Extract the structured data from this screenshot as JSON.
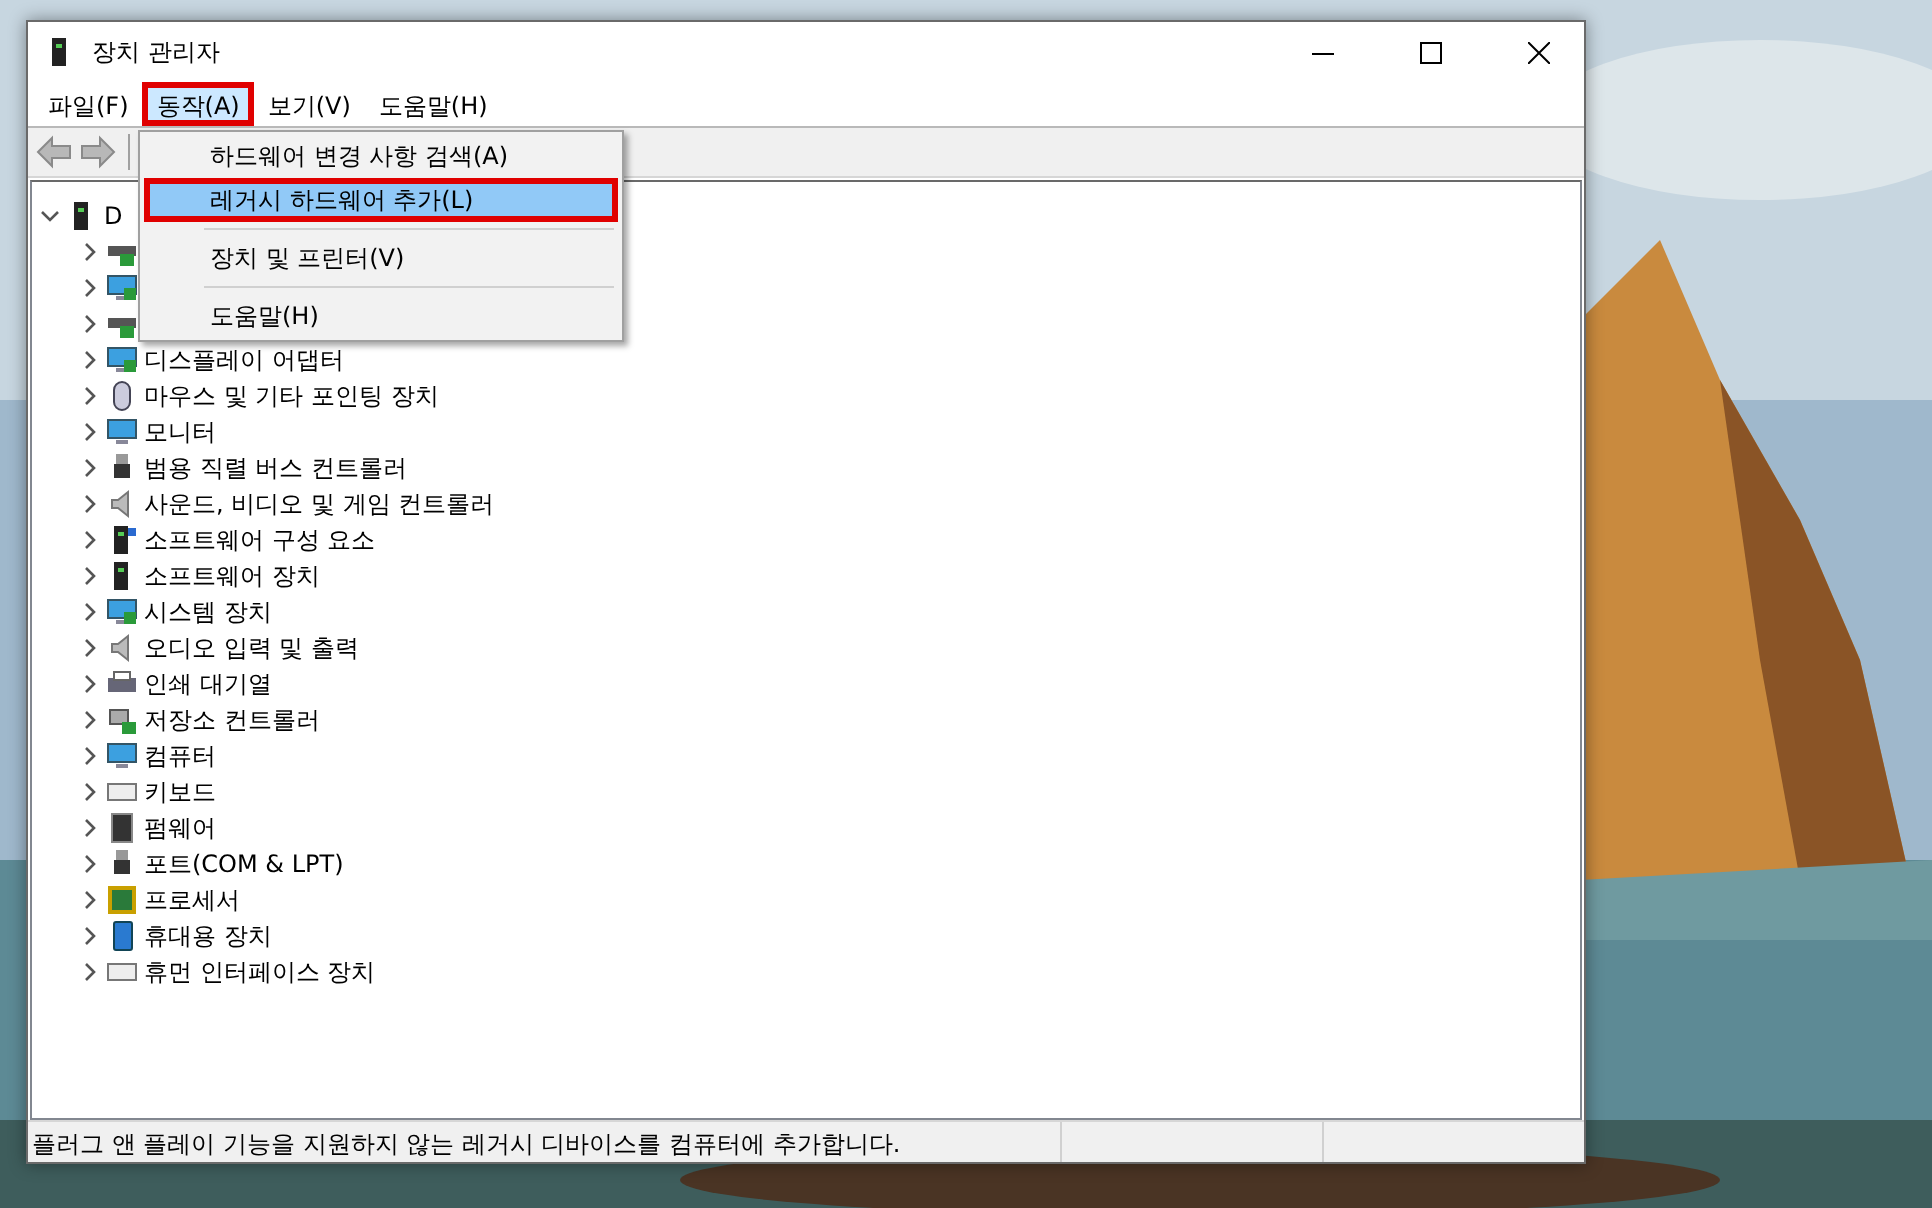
{
  "window": {
    "title": "장치 관리자"
  },
  "menu_bar": [
    {
      "label": "파일(F)",
      "selected": false,
      "highlighted": false
    },
    {
      "label": "동작(A)",
      "selected": true,
      "highlighted": true
    },
    {
      "label": "보기(V)",
      "selected": false,
      "highlighted": false
    },
    {
      "label": "도움말(H)",
      "selected": false,
      "highlighted": false
    }
  ],
  "toolbar": [
    {
      "kind": "back",
      "disabled": true
    },
    {
      "kind": "forward",
      "disabled": true
    }
  ],
  "dropdown_menu": [
    {
      "kind": "item",
      "label": "하드웨어 변경 사항 검색(A)",
      "selected": false,
      "highlighted": false
    },
    {
      "kind": "item",
      "label": "레거시 하드웨어 추가(L)",
      "selected": true,
      "highlighted": true
    },
    {
      "kind": "separator"
    },
    {
      "kind": "item",
      "label": "장치 및 프린터(V)",
      "selected": false,
      "highlighted": false
    },
    {
      "kind": "separator"
    },
    {
      "kind": "item",
      "label": "도움말(H)",
      "selected": false,
      "highlighted": false
    }
  ],
  "tree": {
    "label": "D",
    "expanded": true,
    "children": [
      {
        "expanded": false
      },
      {
        "expanded": false
      },
      {
        "expanded": false
      },
      {
        "label": "디스플레이 어댑터",
        "expanded": false
      },
      {
        "label": "마우스 및 기타 포인팅 장치",
        "expanded": false
      },
      {
        "label": "모니터",
        "expanded": false
      },
      {
        "label": "범용 직렬 버스 컨트롤러",
        "expanded": false
      },
      {
        "label": "사운드, 비디오 및 게임 컨트롤러",
        "expanded": false
      },
      {
        "label": "소프트웨어 구성 요소",
        "expanded": false
      },
      {
        "label": "소프트웨어 장치",
        "expanded": false
      },
      {
        "label": "시스템 장치",
        "expanded": false
      },
      {
        "label": "오디오 입력 및 출력",
        "expanded": false
      },
      {
        "label": "인쇄 대기열",
        "expanded": false
      },
      {
        "label": "저장소 컨트롤러",
        "expanded": false
      },
      {
        "label": "컴퓨터",
        "expanded": false
      },
      {
        "label": "키보드",
        "expanded": false
      },
      {
        "label": "펌웨어",
        "expanded": false
      },
      {
        "label": "포트(COM & LPT)",
        "expanded": false
      },
      {
        "label": "프로세서",
        "expanded": false
      },
      {
        "label": "휴대용 장치",
        "expanded": false
      },
      {
        "label": "휴먼 인터페이스 장치",
        "expanded": false
      }
    ]
  },
  "status_bar": {
    "text": "플러그 앤 플레이 기능을 지원하지 않는 레거시 디바이스를 컴퓨터에 추가합니다."
  }
}
